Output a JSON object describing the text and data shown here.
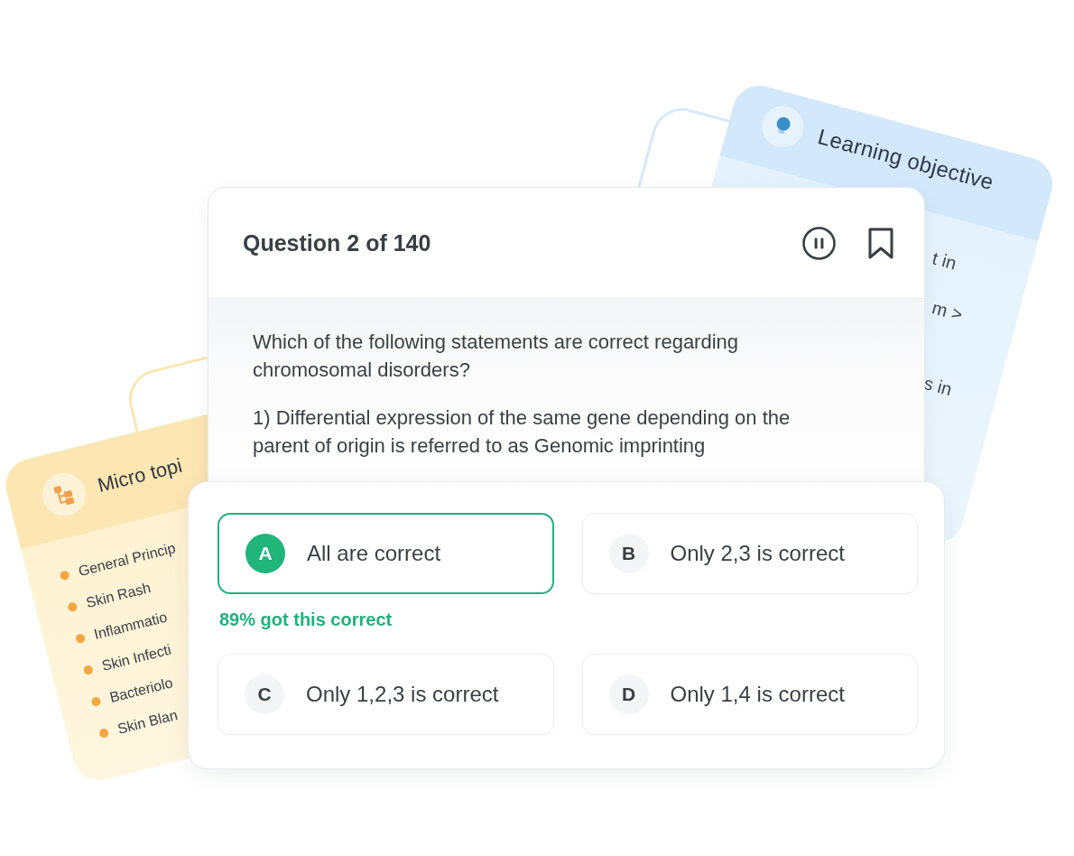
{
  "learning_objective_card": {
    "title": "Learning objective",
    "lines": [
      "t in",
      "m >",
      "s in"
    ]
  },
  "micro_topic_card": {
    "title": "Micro topi",
    "items": [
      "General Princip",
      "Skin Rash",
      "Inflammatio",
      "Skin Infecti",
      "Bacteriolo",
      "Skin Blan"
    ]
  },
  "question_card": {
    "title": "Question 2 of 140",
    "paragraphs": [
      "Which of the following statements are correct regarding chromosomal disorders?",
      "1) Differential expression of the same gene depending on the parent of origin is referred to as Genomic imprinting"
    ]
  },
  "answer_card": {
    "options": [
      {
        "letter": "A",
        "text": "All are correct",
        "selected": true,
        "stat": "89% got this correct"
      },
      {
        "letter": "B",
        "text": "Only 2,3 is correct",
        "selected": false
      },
      {
        "letter": "C",
        "text": "Only 1,2,3 is correct",
        "selected": false
      },
      {
        "letter": "D",
        "text": "Only 1,4 is correct",
        "selected": false
      }
    ]
  }
}
